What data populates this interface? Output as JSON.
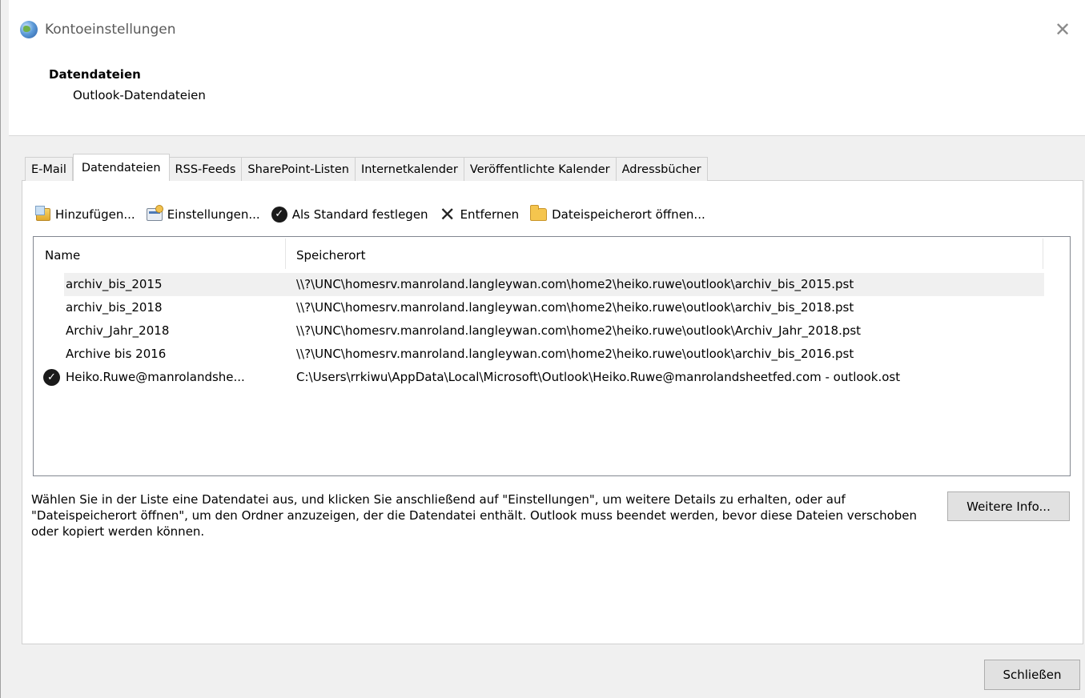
{
  "window": {
    "title": "Kontoeinstellungen",
    "close_glyph": "✕"
  },
  "header": {
    "title": "Datendateien",
    "subtitle": "Outlook-Datendateien"
  },
  "tabs": [
    {
      "label": "E-Mail",
      "active": false
    },
    {
      "label": "Datendateien",
      "active": true
    },
    {
      "label": "RSS-Feeds",
      "active": false
    },
    {
      "label": "SharePoint-Listen",
      "active": false
    },
    {
      "label": "Internetkalender",
      "active": false
    },
    {
      "label": "Veröffentlichte Kalender",
      "active": false
    },
    {
      "label": "Adressbücher",
      "active": false
    }
  ],
  "toolbar": {
    "add_label": "Hinzufügen...",
    "settings_label": "Einstellungen...",
    "default_label": "Als Standard festlegen",
    "remove_label": "Entfernen",
    "open_location_label": "Dateispeicherort öffnen..."
  },
  "list": {
    "columns": {
      "name": "Name",
      "location": "Speicherort"
    },
    "rows": [
      {
        "name": "archiv_bis_2015",
        "location": "\\\\?\\UNC\\homesrv.manroland.langleywan.com\\home2\\heiko.ruwe\\outlook\\archiv_bis_2015.pst",
        "default": false,
        "highlighted": true
      },
      {
        "name": "archiv_bis_2018",
        "location": "\\\\?\\UNC\\homesrv.manroland.langleywan.com\\home2\\heiko.ruwe\\outlook\\archiv_bis_2018.pst",
        "default": false,
        "highlighted": false
      },
      {
        "name": "Archiv_Jahr_2018",
        "location": "\\\\?\\UNC\\homesrv.manroland.langleywan.com\\home2\\heiko.ruwe\\outlook\\Archiv_Jahr_2018.pst",
        "default": false,
        "highlighted": false
      },
      {
        "name": "Archive bis 2016",
        "location": "\\\\?\\UNC\\homesrv.manroland.langleywan.com\\home2\\heiko.ruwe\\outlook\\archiv_bis_2016.pst",
        "default": false,
        "highlighted": false
      },
      {
        "name": "Heiko.Ruwe@manrolandshe...",
        "location": "C:\\Users\\rrkiwu\\AppData\\Local\\Microsoft\\Outlook\\Heiko.Ruwe@manrolandsheetfed.com - outlook.ost",
        "default": true,
        "highlighted": false
      }
    ]
  },
  "info": {
    "text": "Wählen Sie in der Liste eine Datendatei aus, und klicken Sie anschließend auf \"Einstellungen\", um weitere Details zu erhalten, oder auf \"Dateispeicherort öffnen\", um den Ordner anzuzeigen, der die Datendatei enthält. Outlook muss beendet werden, bevor diese Dateien verschoben oder kopiert werden können.",
    "more_button": "Weitere Info..."
  },
  "footer": {
    "close_button": "Schließen"
  },
  "glyphs": {
    "check": "✓",
    "x": "✕"
  }
}
